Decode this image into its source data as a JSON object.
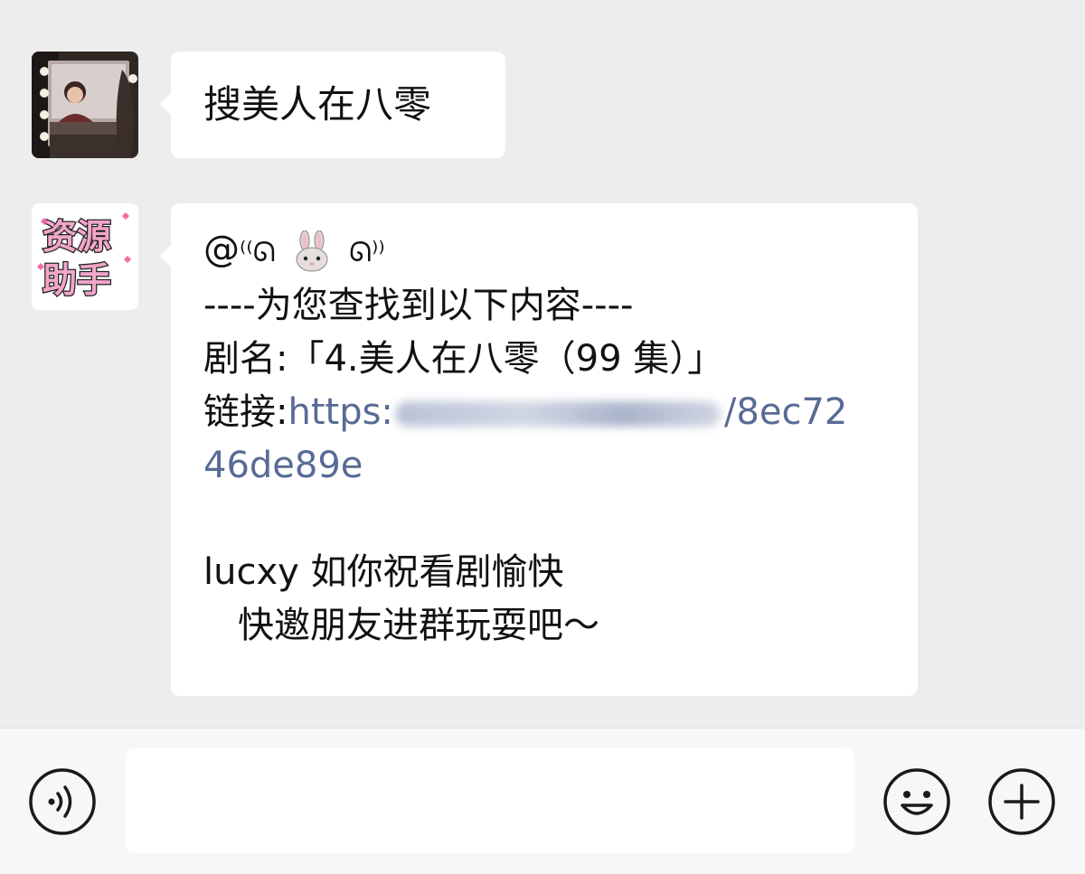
{
  "messages": [
    {
      "sender": "user",
      "avatar": "user-photo-avatar",
      "text": "搜美人在八零"
    },
    {
      "sender": "bot",
      "avatar_text": [
        "资源",
        "助手"
      ],
      "mention_prefix": "@",
      "mention_suffix_left": "⁽⁽ᘏ",
      "mention_emoji": "rabbit-face",
      "mention_suffix_right": "ᘏ⁾⁾",
      "header": "----为您查找到以下内容----",
      "title_label": "剧名:",
      "title_value": "「4.美人在八零（99 集）」",
      "link_label": "链接:",
      "link_start": "https:",
      "link_end": "/8ec72",
      "link_wrap": "46de89e",
      "wish": "lucxy 如你祝看剧愉快",
      "invite": "快邀朋友进群玩耍吧～"
    }
  ],
  "input_bar": {
    "voice_icon": "voice-icon",
    "emoji_icon": "emoji-icon",
    "plus_icon": "plus-icon",
    "placeholder": ""
  },
  "colors": {
    "background": "#ededed",
    "bubble": "#ffffff",
    "link": "#576b95",
    "input_bar": "#f7f7f7"
  }
}
